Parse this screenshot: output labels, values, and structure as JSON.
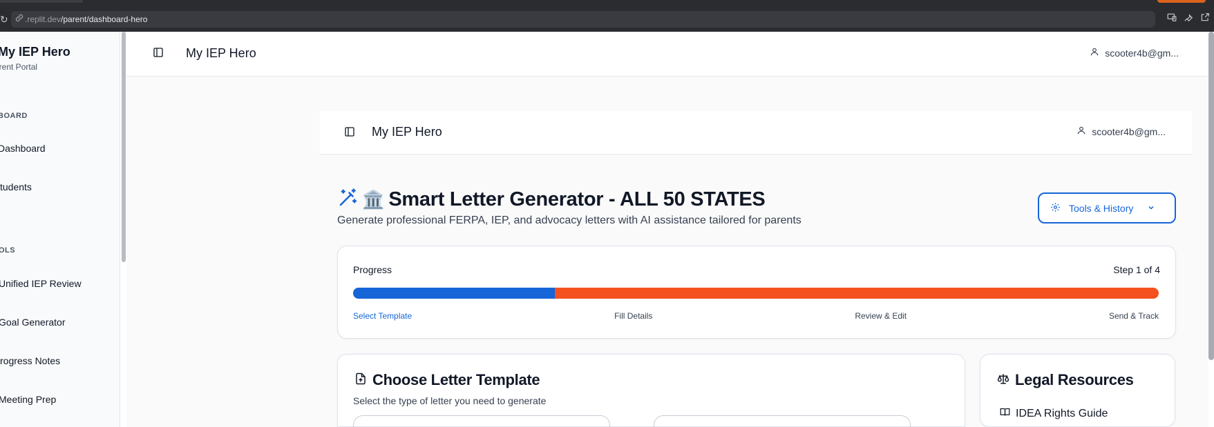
{
  "browser": {
    "url_host": ".replit.dev",
    "url_path": "/parent/dashboard-hero"
  },
  "sidebar": {
    "title": "My IEP Hero",
    "subtitle": "arent Portal",
    "sections": [
      {
        "label": "BOARD",
        "items": [
          "Dashboard",
          "tudents"
        ]
      },
      {
        "label": "OLS",
        "items": [
          "Unified IEP Review",
          "Goal Generator",
          "rogress Notes",
          "Meeting Prep"
        ]
      }
    ]
  },
  "header": {
    "title": "My IEP Hero",
    "user": "scooter4b@gm..."
  },
  "inner_header": {
    "title": "My IEP Hero",
    "user": "scooter4b@gm..."
  },
  "page": {
    "title_emoji_icon": "magic-wand-icon",
    "title_building_icon": "🏛️",
    "title": "Smart Letter Generator - ALL 50 STATES",
    "subtitle": "Generate professional FERPA, IEP, and advocacy letters with AI assistance tailored for parents",
    "tools_button": "Tools & History"
  },
  "progress": {
    "label": "Progress",
    "step_text": "Step 1 of 4",
    "fraction_complete": 0.25,
    "steps": [
      "Select Template",
      "Fill Details",
      "Review & Edit",
      "Send & Track"
    ],
    "active_step": 0
  },
  "template_card": {
    "title": "Choose Letter Template",
    "subtitle": "Select the type of letter you need to generate"
  },
  "legal_card": {
    "title": "Legal Resources",
    "links": [
      "IDEA Rights Guide"
    ]
  },
  "colors": {
    "primary": "#1565d8",
    "progress_remaining": "#f4511e",
    "chrome_dark": "#2b2c30"
  }
}
